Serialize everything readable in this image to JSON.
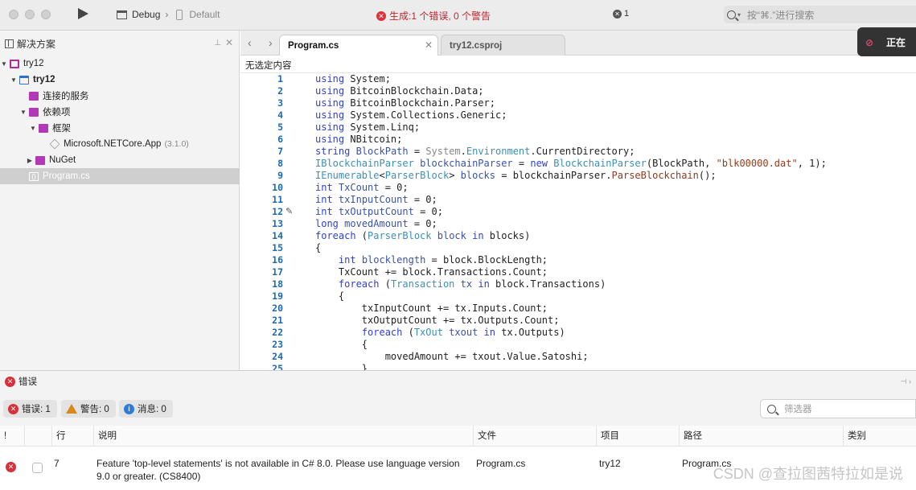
{
  "toolbar": {
    "config": "Debug",
    "target": "Default",
    "status": "生成:1 个错误, 0 个警告",
    "error_badge": "1",
    "search_placeholder": "按“⌘.”进行搜索"
  },
  "solution_panel": {
    "title": "解决方案",
    "tree": [
      {
        "label": "try12",
        "kind": "solution"
      },
      {
        "label": "try12",
        "kind": "project"
      },
      {
        "label": "连接的服务",
        "kind": "folder"
      },
      {
        "label": "依赖项",
        "kind": "folder"
      },
      {
        "label": "框架",
        "kind": "folder"
      },
      {
        "label": "Microsoft.NETCore.App",
        "version": "(3.1.0)",
        "kind": "package"
      },
      {
        "label": "NuGet",
        "kind": "folder"
      },
      {
        "label": "Program.cs",
        "kind": "file"
      }
    ]
  },
  "editor": {
    "tabs": [
      {
        "label": "Program.cs",
        "active": true
      },
      {
        "label": "try12.csproj",
        "active": false
      }
    ],
    "breadcrumb": "无选定内容",
    "popup_text": "正在",
    "line_numbers": [
      "1",
      "2",
      "3",
      "4",
      "5",
      "6",
      "7",
      "8",
      "9",
      "10",
      "11",
      "12",
      "13",
      "14",
      "15",
      "16",
      "17",
      "18",
      "19",
      "20",
      "21",
      "22",
      "23",
      "24",
      "25"
    ]
  },
  "error_panel": {
    "title": "错误",
    "filters": {
      "errors": "错误: 1",
      "warnings": "警告: 0",
      "messages": "消息: 0"
    },
    "filter_placeholder": "筛选器",
    "columns": [
      "!",
      "行",
      "说明",
      "文件",
      "项目",
      "路径",
      "类别"
    ],
    "rows": [
      {
        "line": "7",
        "description": "Feature 'top-level statements' is not available in C# 8.0. Please use language version 9.0 or greater. (CS8400)",
        "file": "Program.cs",
        "project": "try12",
        "path": "Program.cs",
        "category": ""
      }
    ]
  },
  "watermark": "CSDN @查拉图茜特拉如是说"
}
